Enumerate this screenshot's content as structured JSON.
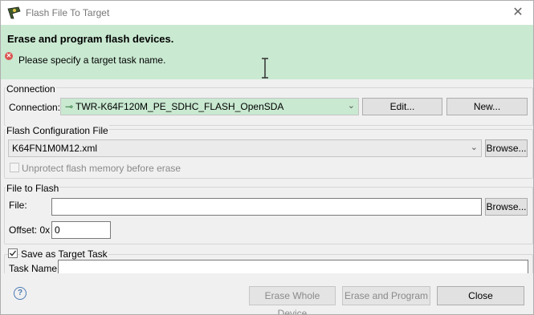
{
  "window": {
    "title": "Flash File To Target",
    "close_glyph": "✕"
  },
  "banner": {
    "title": "Erase and program flash devices.",
    "message": "Please specify a target task name.",
    "error_glyph": "✕"
  },
  "connection": {
    "group_label": "Connection",
    "field_label": "Connection:",
    "selected": "TWR-K64F120M_PE_SDHC_FLASH_OpenSDA",
    "edit_label": "Edit...",
    "new_label": "New..."
  },
  "flash_config": {
    "group_label": "Flash Configuration File",
    "selected": "K64FN1M0M12.xml",
    "browse_label": "Browse...",
    "unprotect_label": "Unprotect flash memory before erase",
    "unprotect_checked": false
  },
  "file_to_flash": {
    "group_label": "File to Flash",
    "file_label": "File:",
    "file_value": "",
    "browse_label": "Browse...",
    "offset_label": "Offset: 0x",
    "offset_value": "0"
  },
  "save_task": {
    "checkbox_label": "Save as Target Task",
    "checked": true,
    "task_name_label": "Task Name:",
    "task_name_value": ""
  },
  "footer": {
    "help_glyph": "?",
    "erase_whole_label": "Erase Whole Device",
    "erase_program_label": "Erase and Program",
    "close_label": "Close"
  },
  "colors": {
    "banner_bg": "#c9e9d1",
    "error_red": "#d9534f",
    "help_blue": "#4a7ab5"
  }
}
